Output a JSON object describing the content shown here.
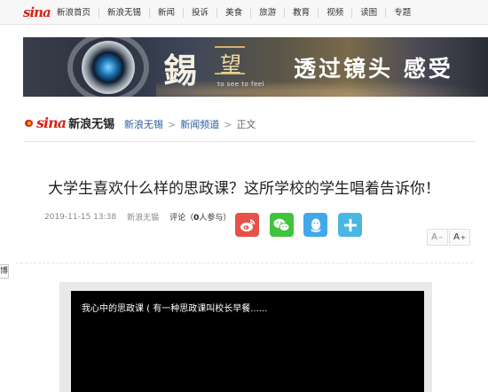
{
  "topnav": {
    "logo": "sina",
    "items": [
      "新浪首页",
      "新浪无锡",
      "新闻",
      "投诉",
      "美食",
      "旅游",
      "教育",
      "视频",
      "读图",
      "专题"
    ]
  },
  "banner": {
    "char_xi": "錫",
    "char_wang": "望",
    "tagline": "to see to feel",
    "slogan": "透过镜头 感受"
  },
  "brand": {
    "sina": "sina",
    "name": "新浪无锡"
  },
  "breadcrumb": {
    "items": [
      "新浪无锡",
      "新闻频道",
      "正文"
    ],
    "separator": ">"
  },
  "article": {
    "title": "大学生喜欢什么样的思政课？这所学校的学生唱着告诉你！",
    "datetime": "2019-11-15 13:38",
    "source": "新浪无锡",
    "comment_label": "评论（",
    "comment_count": "0",
    "comment_suffix": "人参与）"
  },
  "share": {
    "icons": [
      "weibo-icon",
      "wechat-icon",
      "qq-icon",
      "more-icon"
    ]
  },
  "font_size": {
    "decrease": "A",
    "decrease_mark": "−",
    "increase": "A",
    "increase_mark": "+"
  },
  "sidetab": {
    "label": "博"
  },
  "video": {
    "title": "我心中的思政课 ( 有一种思政课叫校长早餐......"
  },
  "colors": {
    "brand_red": "#d9251c",
    "link_blue": "#2b5d99",
    "weibo": "#e6514a",
    "wechat": "#40c33d",
    "qq": "#42a8ea",
    "more": "#4ab6e2"
  }
}
